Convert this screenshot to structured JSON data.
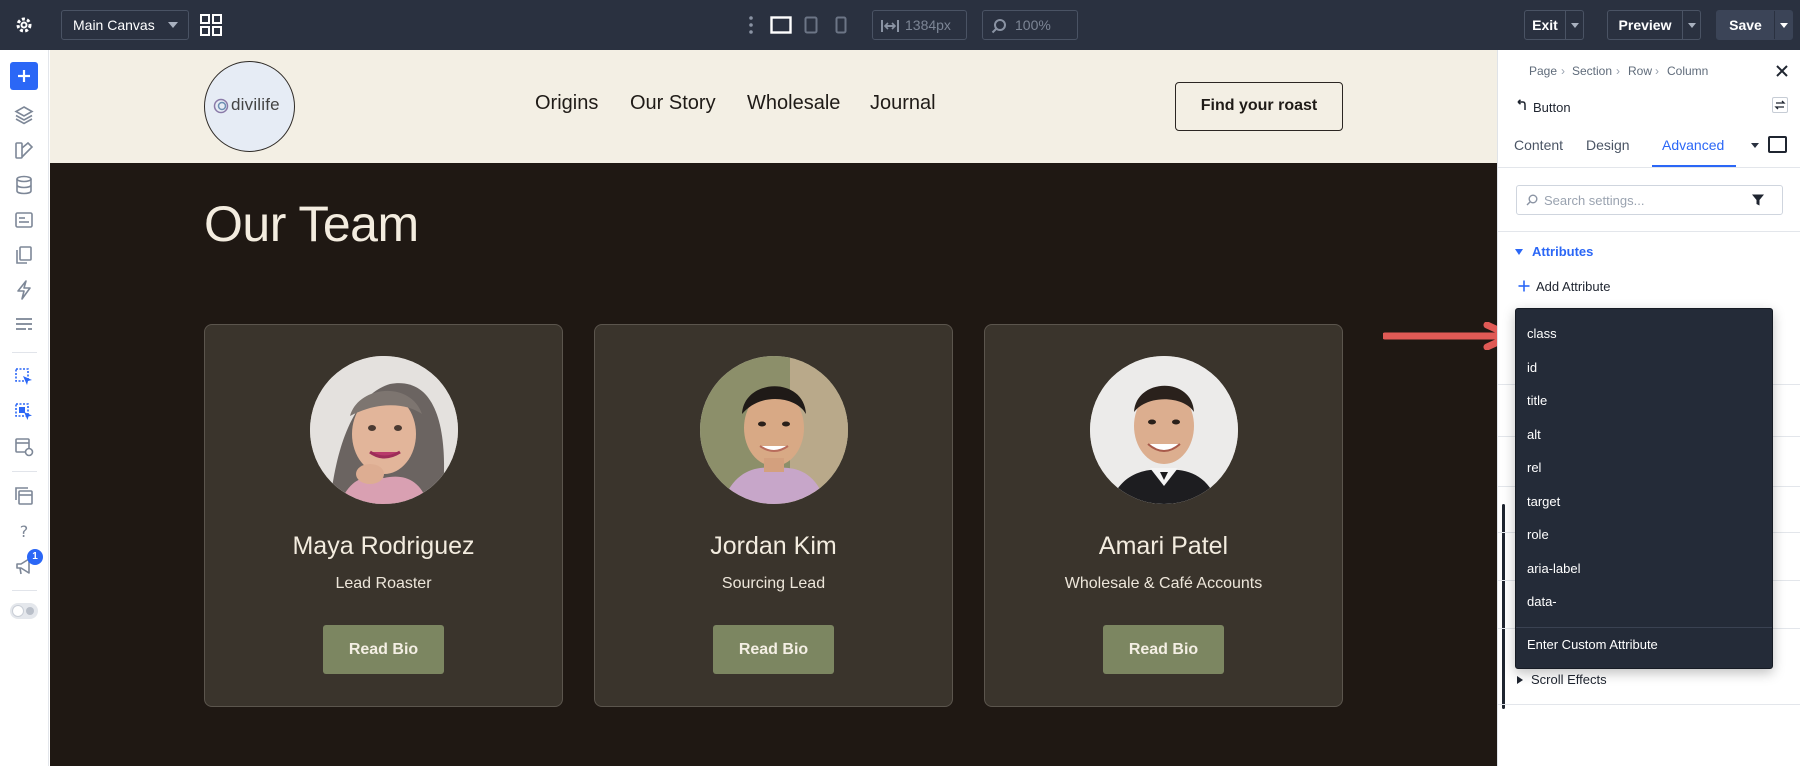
{
  "topbar": {
    "canvas_select": "Main Canvas",
    "width_value": "1384px",
    "zoom_value": "100%",
    "exit_label": "Exit",
    "preview_label": "Preview",
    "save_label": "Save"
  },
  "left_sidebar": {
    "badge_count": "1"
  },
  "site": {
    "logo_text": "divilife",
    "nav": [
      "Origins",
      "Our Story",
      "Wholesale",
      "Journal"
    ],
    "cta_label": "Find your roast",
    "section_title": "Our Team",
    "team": [
      {
        "name": "Maya Rodriguez",
        "role": "Lead Roaster",
        "button": "Read Bio"
      },
      {
        "name": "Jordan Kim",
        "role": "Sourcing Lead",
        "button": "Read Bio"
      },
      {
        "name": "Amari Patel",
        "role": "Wholesale & Café Accounts",
        "button": "Read Bio"
      }
    ]
  },
  "panel": {
    "breadcrumb": [
      "Page",
      "Section",
      "Row",
      "Column"
    ],
    "element_name": "Button",
    "tabs": [
      "Content",
      "Design",
      "Advanced"
    ],
    "active_tab": "Advanced",
    "search_placeholder": "Search settings...",
    "group_title": "Attributes",
    "add_attribute_label": "Add Attribute",
    "scroll_effects_label": "Scroll Effects"
  },
  "dropdown": {
    "items": [
      "class",
      "id",
      "title",
      "alt",
      "rel",
      "target",
      "role",
      "aria-label",
      "data-"
    ],
    "custom_label": "Enter Custom Attribute"
  },
  "colors": {
    "topbar_bg": "#2a3140",
    "accent_blue": "#2b67f6",
    "canvas_dark": "#1f1813",
    "header_cream": "#f3efe4",
    "card_bg": "#3a342c",
    "button_olive": "#7c8661",
    "arrow_red": "#e05a55"
  }
}
